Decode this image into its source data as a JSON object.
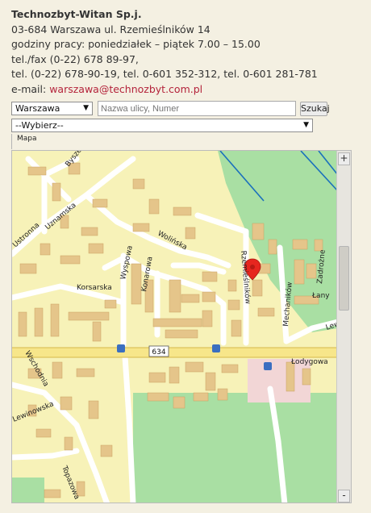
{
  "contact": {
    "company": "Technozbyt-Witan Sp.j.",
    "address": "03-684 Warszawa ul. Rzemieślników 14",
    "hours": "godziny pracy: poniedziałek – piątek 7.00 – 15.00",
    "phone_fax": "tel./fax (0-22) 678 89-97,",
    "phones": "tel. (0-22) 678-90-19, tel. 0-601 352-312, tel. 0-601 281-781",
    "email_label": "e-mail:",
    "email": "warszawa@technozbyt.com.pl"
  },
  "search": {
    "city_value": "Warszawa",
    "street_placeholder": "Nazwa ulicy, Numer",
    "button_label": "Szukaj",
    "option_value": "--Wybierz--"
  },
  "tab": {
    "label": "Mapa"
  },
  "map": {
    "street_labels": {
      "byszewska": "Byszewska",
      "ustronna": "Ustronna",
      "uzna": "Uzna",
      "uznamska": "Uznamska",
      "wolinska": "Wolińska",
      "wyspowa": "Wyspowa",
      "konarowa": "Konarowa",
      "korsarska": "Korsarska",
      "rzemieslnikow": "Rzemieślników",
      "mechanikow": "Mechaników",
      "zadrozne": "Zadrożne",
      "lany": "Łany",
      "lewinowska_east": "Lewinowska",
      "lodygowa": "Łodygowa",
      "wschodnia": "Wschodnia",
      "lewinowska_west": "Lewinowska",
      "topazowa": "Topazowa"
    },
    "road_number": "634",
    "marker_icon": "location-pin-icon",
    "bus_stop_icon": "bus-stop-icon",
    "colors": {
      "land": "#f7f2b8",
      "green": "#a9dfa3",
      "roads": "#ffffff",
      "main_road": "#f7e68a",
      "buildings": "#e5c58a",
      "rail": "#1a6fbd",
      "marker": "#e6261f"
    }
  },
  "scrollbar": {
    "up_arrow": "+",
    "down_arrow": "-"
  }
}
